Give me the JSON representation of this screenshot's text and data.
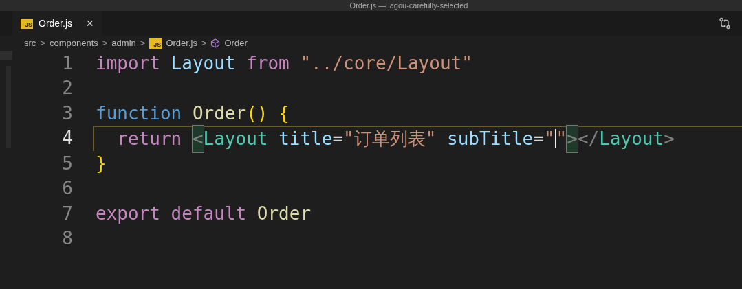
{
  "window": {
    "title": "Order.js — lagou-carefully-selected"
  },
  "tabs": [
    {
      "label": "Order.js",
      "icon": "JS",
      "close": "×",
      "selected": true
    }
  ],
  "breadcrumbs": [
    {
      "kind": "text",
      "label": "src"
    },
    {
      "kind": "text",
      "label": "components"
    },
    {
      "kind": "text",
      "label": "admin"
    },
    {
      "kind": "file",
      "icon": "JS",
      "label": "Order.js"
    },
    {
      "kind": "symbol",
      "label": "Order"
    }
  ],
  "breadcrumb_separator": ">",
  "editor": {
    "lines": [
      {
        "number": "1",
        "current": false,
        "tokens": [
          {
            "text": "import ",
            "color": "#c586c0"
          },
          {
            "text": "Layout ",
            "color": "#9cdcfe"
          },
          {
            "text": "from ",
            "color": "#c586c0"
          },
          {
            "text": "\"../core/Layout\"",
            "color": "#ce9178"
          }
        ]
      },
      {
        "number": "2",
        "current": false
      },
      {
        "number": "3",
        "current": false,
        "tokens": [
          {
            "text": "function ",
            "color": "#569cd6"
          },
          {
            "text": "Order",
            "color": "#dcdcaa"
          },
          {
            "text": "() {",
            "color": "#ffd700"
          }
        ]
      },
      {
        "number": "4",
        "current": true,
        "tokens": [
          {
            "text": "  return ",
            "color": "#c586c0"
          },
          {
            "text": "<",
            "color": "#808080",
            "matched": true
          },
          {
            "text": "Layout ",
            "color": "#4ec9b0"
          },
          {
            "text": "title",
            "color": "#9cdcfe"
          },
          {
            "text": "=",
            "color": "#d4d4d4"
          },
          {
            "text": "\"订单列表\" ",
            "color": "#ce9178"
          },
          {
            "text": "subTitle",
            "color": "#9cdcfe"
          },
          {
            "text": "=",
            "color": "#d4d4d4"
          },
          {
            "text": "\"",
            "color": "#ce9178",
            "cursor_after": true
          },
          {
            "text": "\"",
            "color": "#ce9178"
          },
          {
            "text": ">",
            "color": "#808080",
            "matched": true
          },
          {
            "text": "</",
            "color": "#808080"
          },
          {
            "text": "Layout",
            "color": "#4ec9b0"
          },
          {
            "text": ">",
            "color": "#808080"
          }
        ]
      },
      {
        "number": "5",
        "current": false,
        "tokens": [
          {
            "text": "}",
            "color": "#ffd700"
          }
        ]
      },
      {
        "number": "6",
        "current": false
      },
      {
        "number": "7",
        "current": false,
        "tokens": [
          {
            "text": "export ",
            "color": "#c586c0"
          },
          {
            "text": "default ",
            "color": "#c586c0"
          },
          {
            "text": "Order",
            "color": "#dcdcaa"
          }
        ]
      },
      {
        "number": "8",
        "current": false
      }
    ]
  }
}
